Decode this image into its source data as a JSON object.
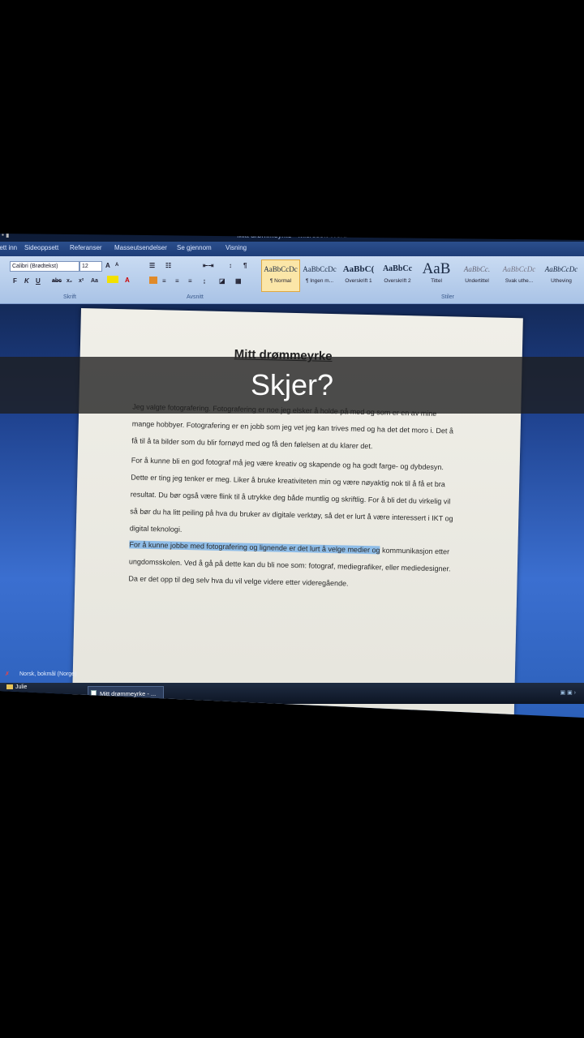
{
  "window": {
    "title": "Mitt drømmeyrke - Microsoft Word",
    "quick_access": "▪ ▮"
  },
  "menu": {
    "items": [
      "Sett inn",
      "Sideoppsett",
      "Referanser",
      "Masseutsendelser",
      "Se gjennom",
      "Visning"
    ]
  },
  "ribbon": {
    "font_name": "Calibri (Brødtekst)",
    "font_size": "12",
    "format_buttons": [
      "F",
      "K",
      "U",
      "abc",
      "x₂",
      "x²",
      "Aa"
    ],
    "styles": [
      {
        "sample": "AaBbCcDc",
        "label": "¶ Normal"
      },
      {
        "sample": "AaBbCcDc",
        "label": "¶ Ingen m..."
      },
      {
        "sample": "AaBbC(",
        "label": "Overskrift 1"
      },
      {
        "sample": "AaBbCc",
        "label": "Overskrift 2"
      },
      {
        "sample": "AaB",
        "label": "Tittel"
      },
      {
        "sample": "AaBbCc.",
        "label": "Undertittel"
      },
      {
        "sample": "AaBbCcDc",
        "label": "Svak uthe..."
      },
      {
        "sample": "AaBbCcDc",
        "label": "Utheving"
      }
    ],
    "groups": {
      "font": "Skrift",
      "paragraph": "Avsnitt",
      "styles": "Stiler"
    }
  },
  "document": {
    "title": "Mitt drømmeyrke",
    "paragraphs": [
      "Jeg valgte fotografering. Fotografering er noe jeg elsker å holde på med og som er en av mine mange hobbyer. Fotografering er en jobb som jeg vet jeg kan trives med og ha det det moro i. Det å få til å ta bilder som du blir fornøyd med og få den følelsen at du klarer det.",
      "For å kunne bli en god fotograf må jeg være kreativ og skapende og ha godt farge- og dybdesyn. Dette er ting jeg tenker er meg. Liker å bruke kreativiteten min og være nøyaktig nok til å få et bra resultat. Du bør også være flink til å utrykke deg både muntlig og skriftlig. For å bli det du virkelig vil så bør du ha litt peiling på hva du bruker av digitale verktøy, så det er lurt å være interessert i IKT og digital teknologi."
    ],
    "p3_highlight": "For å kunne jobbe med fotografering og lignende er det lurt å velge medier og",
    "p3_rest": "kommunikasjon etter ungdomsskolen. Ved å gå på dette kan du bli noe som: fotograf, mediegrafiker, eller mediedesigner. Da er det opp til deg selv hva du vil velge videre etter videregående."
  },
  "status": {
    "language": "Norsk, bokmål (Norge)"
  },
  "taskbar": {
    "folder": "Julie",
    "active_window": "Mitt drømmeyrke - ..."
  },
  "overlay": {
    "caption": "Skjer?"
  }
}
